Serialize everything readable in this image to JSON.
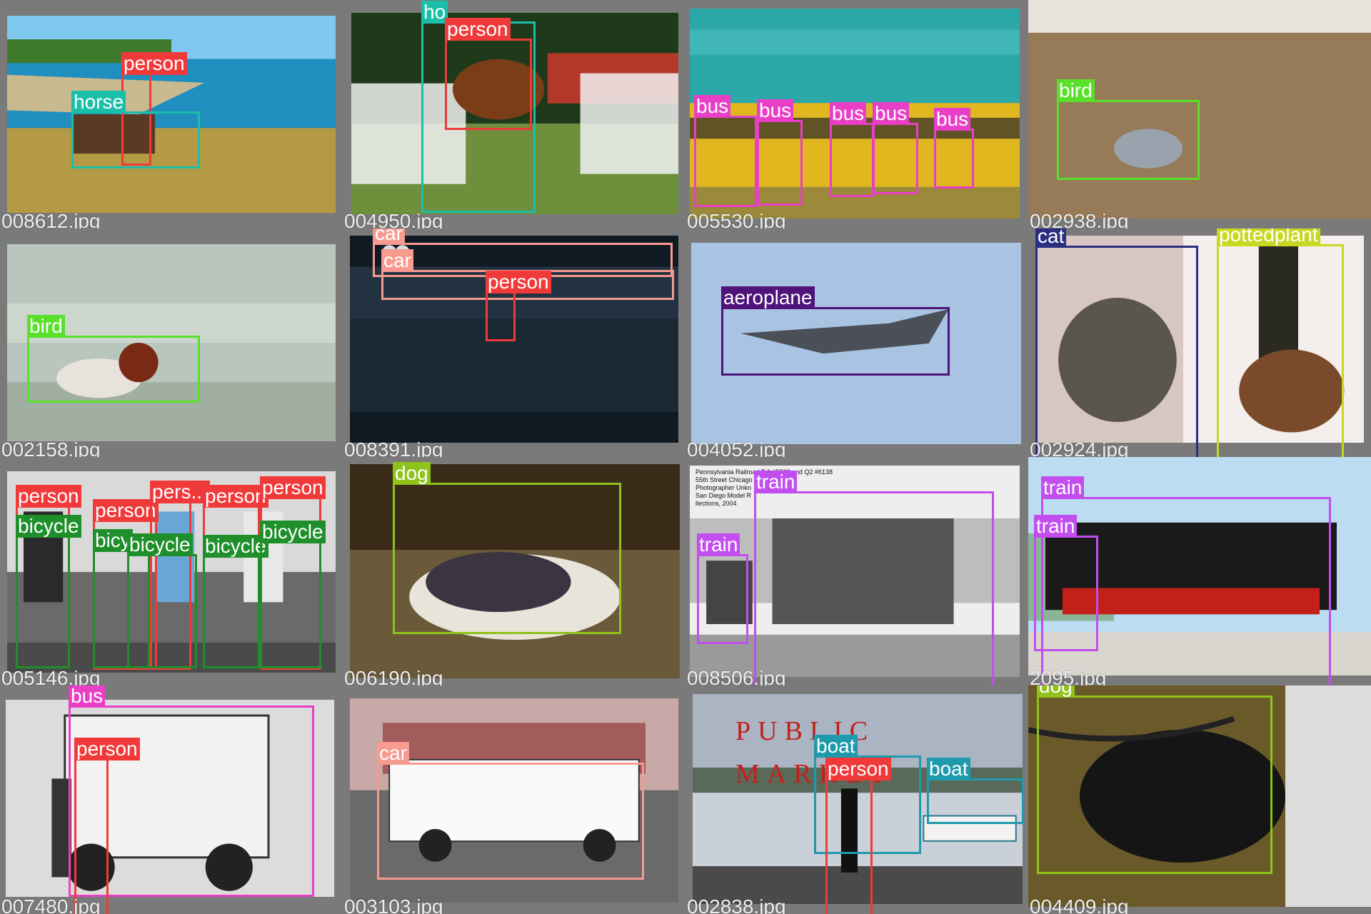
{
  "colors": {
    "person": "#f03a3a",
    "horse": "#1bbfa8",
    "bus": "#e83fc6",
    "bird": "#58e02a",
    "car": "#f79a90",
    "aeroplane": "#4f137a",
    "cat": "#2a2e80",
    "pottedplant": "#c8d821",
    "bicycle": "#1f8f2b",
    "dog": "#8fc21a",
    "train": "#c24ef0",
    "boat": "#1f9aac"
  },
  "tiles": [
    {
      "file": "008612.jpg",
      "scene": "coast",
      "boxes": [
        {
          "cls": "person",
          "label": "person"
        },
        {
          "cls": "horse",
          "label": "horse"
        }
      ]
    },
    {
      "file": "004950.jpg",
      "scene": "jump",
      "boxes": [
        {
          "cls": "horse",
          "label": "ho"
        },
        {
          "cls": "person",
          "label": "person"
        }
      ]
    },
    {
      "file": "005530.jpg",
      "scene": "buses",
      "boxes": [
        {
          "cls": "bus",
          "label": "bus"
        },
        {
          "cls": "bus",
          "label": "bus"
        },
        {
          "cls": "bus",
          "label": "bus"
        },
        {
          "cls": "bus",
          "label": "bus"
        },
        {
          "cls": "bus",
          "label": "bus"
        }
      ]
    },
    {
      "file": "002938.jpg",
      "scene": "grass",
      "boxes": [
        {
          "cls": "bird",
          "label": "bird"
        }
      ]
    },
    {
      "file": "002158.jpg",
      "scene": "water",
      "boxes": [
        {
          "cls": "bird",
          "label": "bird"
        }
      ]
    },
    {
      "file": "008391.jpg",
      "scene": "car",
      "boxes": [
        {
          "cls": "car",
          "label": "car"
        },
        {
          "cls": "car",
          "label": "car"
        },
        {
          "cls": "person",
          "label": "person"
        }
      ]
    },
    {
      "file": "004052.jpg",
      "scene": "sky",
      "boxes": [
        {
          "cls": "aeroplane",
          "label": "aeroplane"
        }
      ]
    },
    {
      "file": "002924.jpg",
      "scene": "window",
      "boxes": [
        {
          "cls": "cat",
          "label": "cat"
        },
        {
          "cls": "pottedplant",
          "label": "pottedplant"
        }
      ]
    },
    {
      "file": "005146.jpg",
      "scene": "cyclists",
      "boxes": [
        {
          "cls": "person",
          "label": "person"
        },
        {
          "cls": "person",
          "label": "person"
        },
        {
          "cls": "person",
          "label": "pers..."
        },
        {
          "cls": "person",
          "label": "person"
        },
        {
          "cls": "person",
          "label": "person"
        },
        {
          "cls": "bicycle",
          "label": "bicycle"
        },
        {
          "cls": "bicycle",
          "label": "bicy"
        },
        {
          "cls": "bicycle",
          "label": "bicycle"
        },
        {
          "cls": "bicycle",
          "label": "bicycle"
        },
        {
          "cls": "bicycle",
          "label": "bicycle"
        }
      ]
    },
    {
      "file": "006190.jpg",
      "scene": "bed",
      "boxes": [
        {
          "cls": "dog",
          "label": "dog"
        }
      ]
    },
    {
      "file": "008506.jpg",
      "scene": "trainbw",
      "caption": [
        "Pennsylvania Railroad T-1 #5533 and Q2 #6138",
        "55th Street Chicago",
        "Photographer Unkn",
        "San Diego Model R",
        "llections, 2004"
      ],
      "boxes": [
        {
          "cls": "train",
          "label": "train"
        },
        {
          "cls": "train",
          "label": "train"
        }
      ]
    },
    {
      "file": "2095.jpg",
      "scene": "loco",
      "boxes": [
        {
          "cls": "train",
          "label": "train"
        },
        {
          "cls": "train",
          "label": "train"
        }
      ]
    },
    {
      "file": "007480.jpg",
      "scene": "oldbus",
      "boxes": [
        {
          "cls": "bus",
          "label": "bus"
        },
        {
          "cls": "person",
          "label": "person"
        }
      ]
    },
    {
      "file": "003103.jpg",
      "scene": "van",
      "boxes": [
        {
          "cls": "car",
          "label": "car"
        }
      ]
    },
    {
      "file": "002838.jpg",
      "scene": "market",
      "sign": [
        "PUBLIC",
        "MARKET"
      ],
      "boxes": [
        {
          "cls": "boat",
          "label": "boat"
        },
        {
          "cls": "person",
          "label": "person"
        },
        {
          "cls": "boat",
          "label": "boat"
        }
      ]
    },
    {
      "file": "004409.jpg",
      "scene": "dogblanket",
      "boxes": [
        {
          "cls": "dog",
          "label": "dog"
        }
      ]
    }
  ]
}
